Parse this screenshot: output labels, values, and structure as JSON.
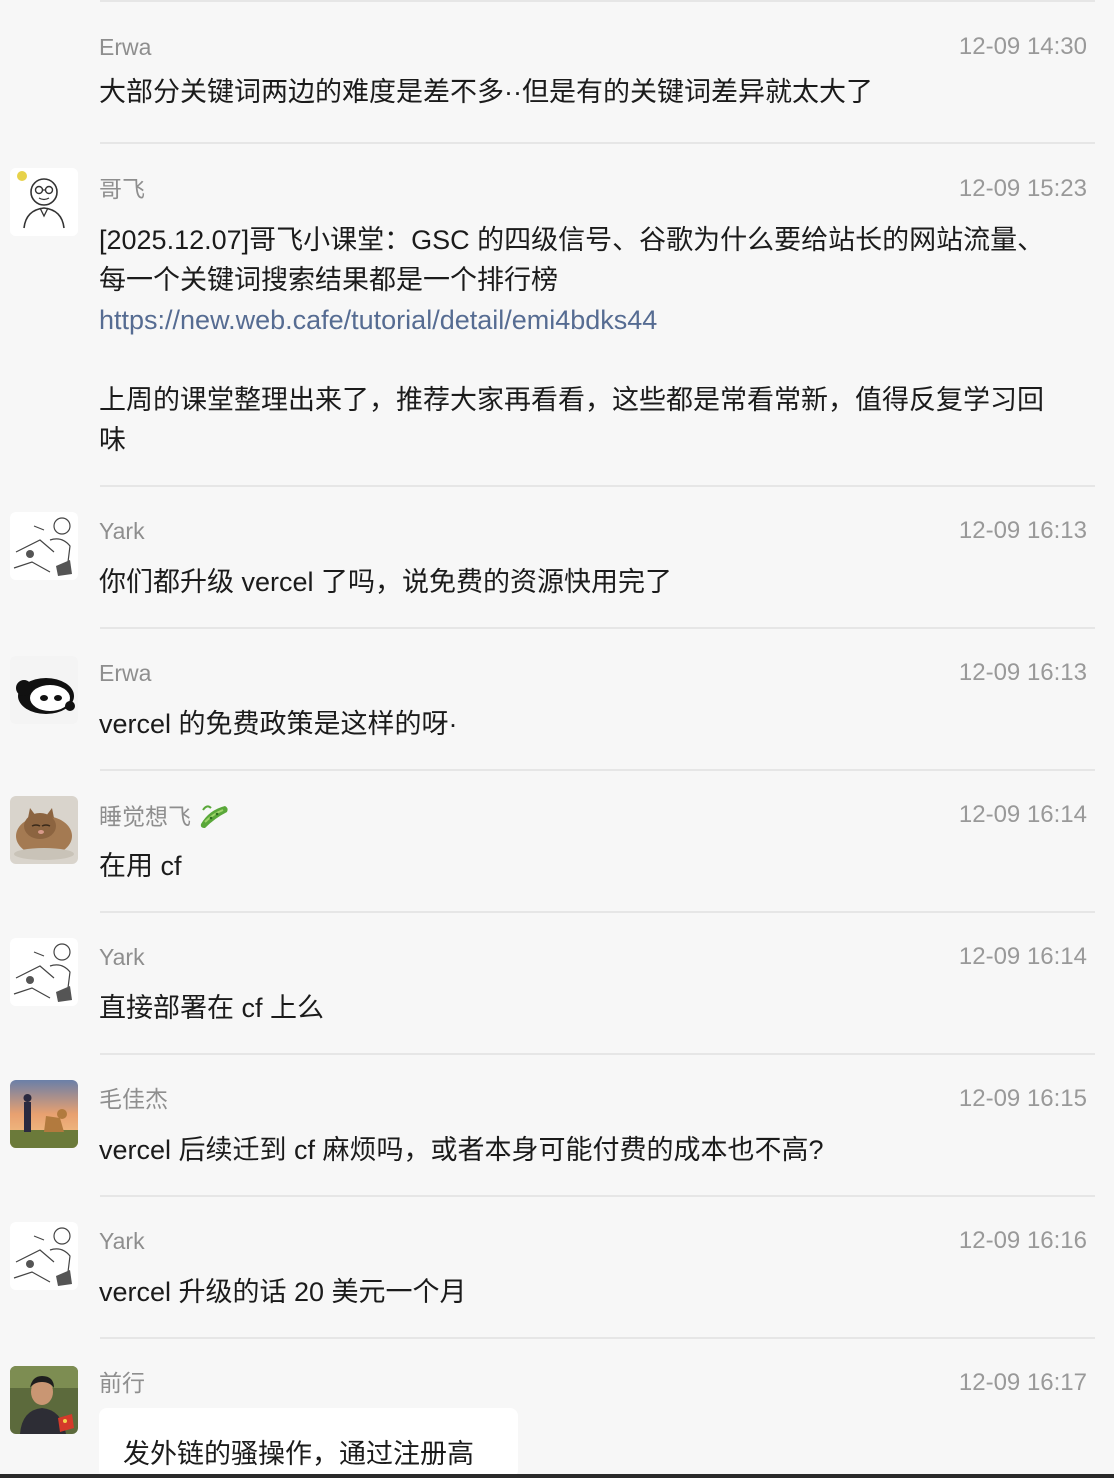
{
  "messages": [
    {
      "sender": "Erwa",
      "time": "12-09 14:30",
      "text": "大部分关键词两边的难度是差不多··但是有的关键词差异就太大了",
      "avatar_icon": "none-visible"
    },
    {
      "sender": "哥飞",
      "time": "12-09 15:23",
      "line1": "[2025.12.07]哥飞小课堂：GSC 的四级信号、谷歌为什么要给站长的网站流量、",
      "line2": "每一个关键词搜索结果都是一个排行榜",
      "link": "https://new.web.cafe/tutorial/detail/emi4bdks44",
      "line3": "上周的课堂整理出来了，推荐大家再看看，这些都是常看常新，值得反复学习回",
      "line4": "味",
      "avatar_icon": "cartoon-man-with-glasses-avatar-icon"
    },
    {
      "sender": "Yark",
      "time": "12-09 16:13",
      "text": "你们都升级 vercel 了吗，说免费的资源快用完了",
      "avatar_icon": "line-sketch-avatar-icon"
    },
    {
      "sender": "Erwa",
      "time": "12-09 16:13",
      "text": "vercel 的免费政策是这样的呀·",
      "avatar_icon": "panda-avatar-icon"
    },
    {
      "sender": "睡觉想飞",
      "time": "12-09 16:14",
      "text": "在用 cf",
      "avatar_icon": "cat-photo-avatar-icon",
      "badge_icon": "cucumber-icon"
    },
    {
      "sender": "Yark",
      "time": "12-09 16:14",
      "text": "直接部署在 cf 上么",
      "avatar_icon": "line-sketch-avatar-icon"
    },
    {
      "sender": "毛佳杰",
      "time": "12-09 16:15",
      "text": "vercel 后续迁到 cf 麻烦吗，或者本身可能付费的成本也不高?",
      "avatar_icon": "sunset-dog-avatar-icon"
    },
    {
      "sender": "Yark",
      "time": "12-09 16:16",
      "text": "vercel 升级的话 20 美元一个月",
      "avatar_icon": "line-sketch-avatar-icon"
    },
    {
      "sender": "前行",
      "time": "12-09 16:17",
      "quote": "发外链的骚操作，通过注册高",
      "avatar_icon": "person-photo-avatar-icon"
    }
  ],
  "colors": {
    "background": "#f7f7f7",
    "link": "#566c92",
    "sender": "#8e8e8e",
    "time": "#999999",
    "text": "#1b1b1b"
  }
}
